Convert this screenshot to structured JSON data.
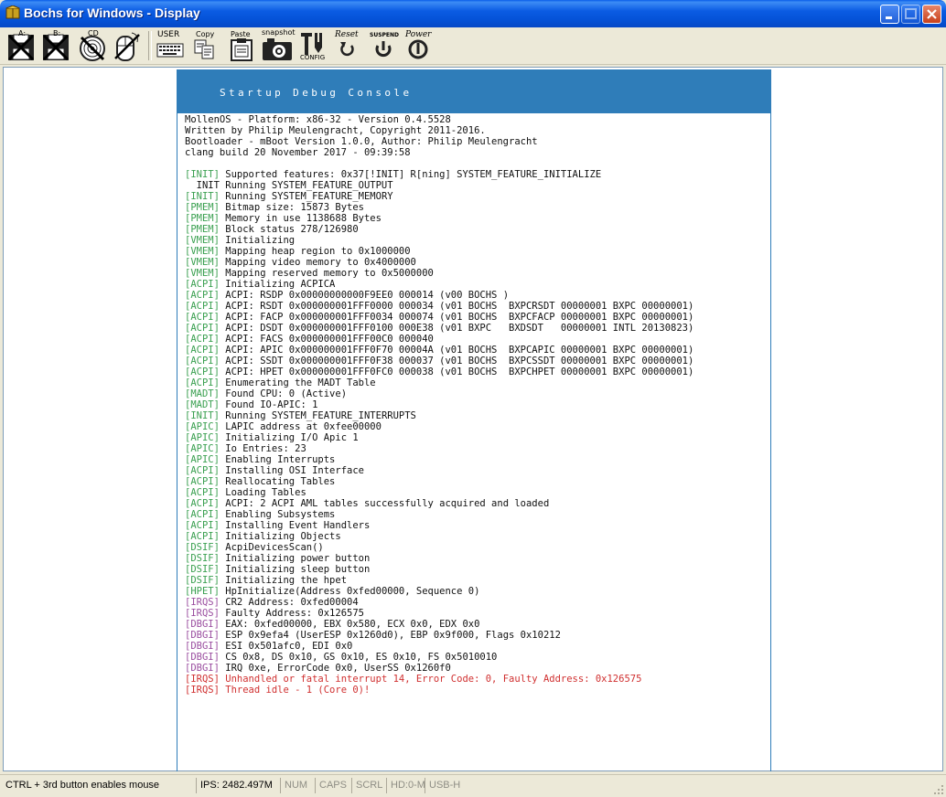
{
  "window": {
    "title": "Bochs for Windows - Display",
    "icon": "bochs-app-icon"
  },
  "toolbar": {
    "items": [
      {
        "label": "A:",
        "icon": "floppy-a-icon"
      },
      {
        "label": "B:",
        "icon": "floppy-b-icon"
      },
      {
        "label": "CD",
        "icon": "cdrom-icon"
      },
      {
        "label": "",
        "icon": "mouse-icon"
      },
      {
        "label": "USER",
        "icon": "keyboard-icon"
      },
      {
        "label": "Copy",
        "icon": "copy-icon"
      },
      {
        "label": "Paste",
        "icon": "paste-icon"
      },
      {
        "label": "snapshot",
        "icon": "camera-icon"
      },
      {
        "label": "CONFIG",
        "icon": "config-icon"
      },
      {
        "label": "Reset",
        "icon": "reset-icon"
      },
      {
        "label": "SUSPEND",
        "icon": "suspend-icon"
      },
      {
        "label": "Power",
        "icon": "power-icon"
      }
    ]
  },
  "console": {
    "title": "Startup Debug Console",
    "header_color": "#2f7db9",
    "lines": [
      {
        "tag": "",
        "text": "MollenOS - Platform: x86-32 - Version 0.4.5528",
        "style": "plain"
      },
      {
        "tag": "",
        "text": "Written by Philip Meulengracht, Copyright 2011-2016.",
        "style": "plain"
      },
      {
        "tag": "",
        "text": "Bootloader - mBoot Version 1.0.0, Author: Philip Meulengracht",
        "style": "plain"
      },
      {
        "tag": "",
        "text": "clang build 20 November 2017 - 09:39:58",
        "style": "plain"
      },
      {
        "tag": "",
        "text": "",
        "style": "plain"
      },
      {
        "tag": "[INIT]",
        "text": " Supported features: 0x37[!INIT] R[ning] SYSTEM_FEATURE_INITIALIZE",
        "style": "green"
      },
      {
        "tag": "",
        "text": "  INIT Running SYSTEM_FEATURE_OUTPUT",
        "style": "plain"
      },
      {
        "tag": "[INIT]",
        "text": " Running SYSTEM_FEATURE_MEMORY",
        "style": "green"
      },
      {
        "tag": "[PMEM]",
        "text": " Bitmap size: 15873 Bytes",
        "style": "green"
      },
      {
        "tag": "[PMEM]",
        "text": " Memory in use 1138688 Bytes",
        "style": "green"
      },
      {
        "tag": "[PMEM]",
        "text": " Block status 278/126980",
        "style": "green"
      },
      {
        "tag": "[VMEM]",
        "text": " Initializing",
        "style": "green"
      },
      {
        "tag": "[VMEM]",
        "text": " Mapping heap region to 0x1000000",
        "style": "green"
      },
      {
        "tag": "[VMEM]",
        "text": " Mapping video memory to 0x4000000",
        "style": "green"
      },
      {
        "tag": "[VMEM]",
        "text": " Mapping reserved memory to 0x5000000",
        "style": "green"
      },
      {
        "tag": "[ACPI]",
        "text": " Initializing ACPICA",
        "style": "green"
      },
      {
        "tag": "[ACPI]",
        "text": " ACPI: RSDP 0x00000000000F9EE0 000014 (v00 BOCHS )",
        "style": "green"
      },
      {
        "tag": "[ACPI]",
        "text": " ACPI: RSDT 0x000000001FFF0000 000034 (v01 BOCHS  BXPCRSDT 00000001 BXPC 00000001)",
        "style": "green"
      },
      {
        "tag": "[ACPI]",
        "text": " ACPI: FACP 0x000000001FFF0034 000074 (v01 BOCHS  BXPCFACP 00000001 BXPC 00000001)",
        "style": "green"
      },
      {
        "tag": "[ACPI]",
        "text": " ACPI: DSDT 0x000000001FFF0100 000E38 (v01 BXPC   BXDSDT   00000001 INTL 20130823)",
        "style": "green"
      },
      {
        "tag": "[ACPI]",
        "text": " ACPI: FACS 0x000000001FFF00C0 000040",
        "style": "green"
      },
      {
        "tag": "[ACPI]",
        "text": " ACPI: APIC 0x000000001FFF0F70 00004A (v01 BOCHS  BXPCAPIC 00000001 BXPC 00000001)",
        "style": "green"
      },
      {
        "tag": "[ACPI]",
        "text": " ACPI: SSDT 0x000000001FFF0F38 000037 (v01 BOCHS  BXPCSSDT 00000001 BXPC 00000001)",
        "style": "green"
      },
      {
        "tag": "[ACPI]",
        "text": " ACPI: HPET 0x000000001FFF0FC0 000038 (v01 BOCHS  BXPCHPET 00000001 BXPC 00000001)",
        "style": "green"
      },
      {
        "tag": "[ACPI]",
        "text": " Enumerating the MADT Table",
        "style": "green"
      },
      {
        "tag": "[MADT]",
        "text": " Found CPU: 0 (Active)",
        "style": "green"
      },
      {
        "tag": "[MADT]",
        "text": " Found IO-APIC: 1",
        "style": "green"
      },
      {
        "tag": "[INIT]",
        "text": " Running SYSTEM_FEATURE_INTERRUPTS",
        "style": "green"
      },
      {
        "tag": "[APIC]",
        "text": " LAPIC address at 0xfee00000",
        "style": "green"
      },
      {
        "tag": "[APIC]",
        "text": " Initializing I/O Apic 1",
        "style": "green"
      },
      {
        "tag": "[APIC]",
        "text": " Io Entries: 23",
        "style": "green"
      },
      {
        "tag": "[APIC]",
        "text": " Enabling Interrupts",
        "style": "green"
      },
      {
        "tag": "[ACPI]",
        "text": " Installing OSI Interface",
        "style": "green"
      },
      {
        "tag": "[ACPI]",
        "text": " Reallocating Tables",
        "style": "green"
      },
      {
        "tag": "[ACPI]",
        "text": " Loading Tables",
        "style": "green"
      },
      {
        "tag": "[ACPI]",
        "text": " ACPI: 2 ACPI AML tables successfully acquired and loaded",
        "style": "green"
      },
      {
        "tag": "[ACPI]",
        "text": " Enabling Subsystems",
        "style": "green"
      },
      {
        "tag": "[ACPI]",
        "text": " Installing Event Handlers",
        "style": "green"
      },
      {
        "tag": "[ACPI]",
        "text": " Initializing Objects",
        "style": "green"
      },
      {
        "tag": "[DSIF]",
        "text": " AcpiDevicesScan()",
        "style": "green"
      },
      {
        "tag": "[DSIF]",
        "text": " Initializing power button",
        "style": "green"
      },
      {
        "tag": "[DSIF]",
        "text": " Initializing sleep button",
        "style": "green"
      },
      {
        "tag": "[DSIF]",
        "text": " Initializing the hpet",
        "style": "green"
      },
      {
        "tag": "[HPET]",
        "text": " HpInitialize(Address 0xfed00000, Sequence 0)",
        "style": "green"
      },
      {
        "tag": "[IRQS]",
        "text": " CR2 Address: 0xfed00004",
        "style": "purple"
      },
      {
        "tag": "[IRQS]",
        "text": " Faulty Address: 0x126575",
        "style": "purple"
      },
      {
        "tag": "[DBGI]",
        "text": " EAX: 0xfed00000, EBX 0x580, ECX 0x0, EDX 0x0",
        "style": "purple"
      },
      {
        "tag": "[DBGI]",
        "text": " ESP 0x9efa4 (UserESP 0x1260d0), EBP 0x9f000, Flags 0x10212",
        "style": "purple"
      },
      {
        "tag": "[DBGI]",
        "text": " ESI 0x501afc0, EDI 0x0",
        "style": "purple"
      },
      {
        "tag": "[DBGI]",
        "text": " CS 0x8, DS 0x10, GS 0x10, ES 0x10, FS 0x5010010",
        "style": "purple"
      },
      {
        "tag": "[DBGI]",
        "text": " IRQ 0xe, ErrorCode 0x0, UserSS 0x1260f0",
        "style": "purple"
      },
      {
        "tag": "[IRQS]",
        "text": " Unhandled or fatal interrupt 14, Error Code: 0, Faulty Address: 0x126575",
        "style": "red"
      },
      {
        "tag": "[IRQS]",
        "text": " Thread idle - 1 (Core 0)!",
        "style": "red"
      }
    ]
  },
  "statusbar": {
    "hint": "CTRL + 3rd button enables mouse",
    "ips": "IPS: 2482.497M",
    "num": "NUM",
    "caps": "CAPS",
    "scrl": "SCRL",
    "hd": "HD:0-M",
    "usb": "USB-HD"
  },
  "colors": {
    "tag_green": "#3aa050",
    "tag_purple": "#9b4fa0",
    "error_red": "#d03030"
  }
}
